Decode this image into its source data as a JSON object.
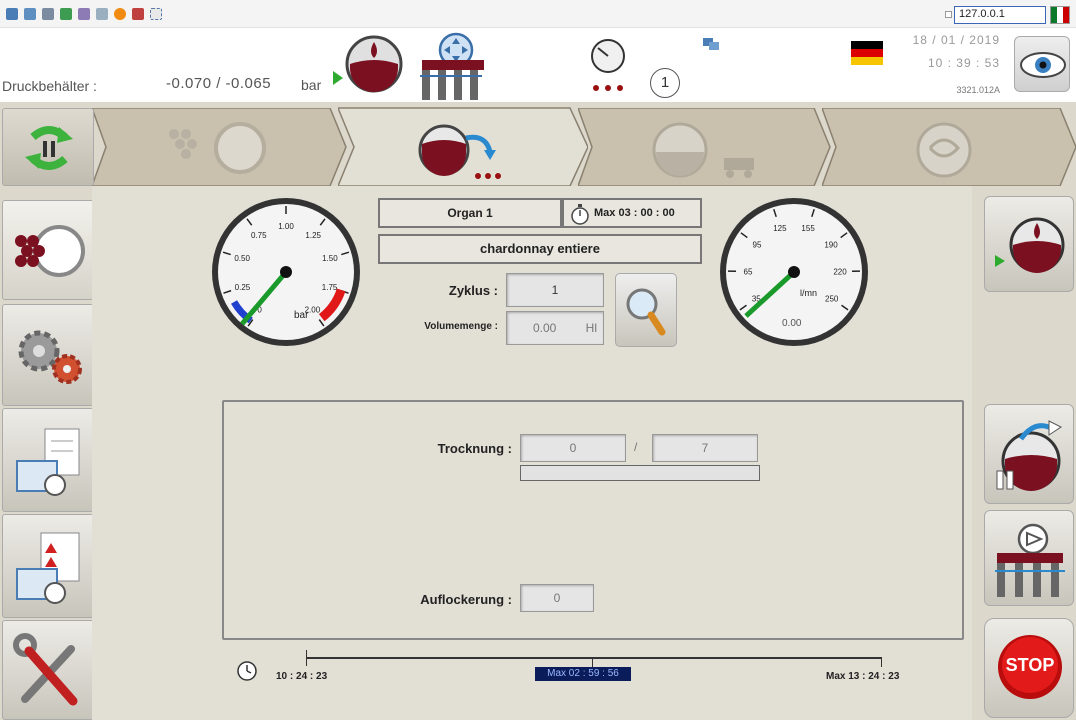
{
  "toolbar": {
    "ip_address": "127.0.0.1"
  },
  "header": {
    "druck_label": "Druckbehälter :",
    "druck_values": "-0.070  /  -0.065",
    "druck_unit": "bar",
    "counter": "1",
    "date": "18 / 01 / 2019",
    "time": "10 : 39 : 53",
    "code": "3321.012A"
  },
  "gauge_left": {
    "ticks": [
      "0",
      "0.25",
      "0.50",
      "0.75",
      "1.00",
      "1.25",
      "1.50",
      "1.75",
      "2.00"
    ],
    "unit": "bar"
  },
  "gauge_right": {
    "ticks": [
      "35",
      "65",
      "95",
      "125",
      "155",
      "190",
      "220",
      "250"
    ],
    "unit": "l/mn",
    "value_text": "0.00"
  },
  "program": {
    "name": "Organ 1",
    "timer": "Max 03 : 00 : 00",
    "product": "chardonnay entiere",
    "zyklus_label": "Zyklus :",
    "zyklus_value": "1",
    "volumen_label": "Volumemenge :",
    "volumen_value": "0.00",
    "volumen_unit": "Hl"
  },
  "panel": {
    "trocknung_label": "Trocknung :",
    "trocknung_value": "0",
    "trocknung_sep": "/",
    "trocknung_total": "7",
    "trocknung_progress": 0.0,
    "auflockerung_label": "Auflockerung :",
    "auflockerung_value": "0"
  },
  "timeline": {
    "start": "10 : 24 : 23",
    "current": "Max 02 : 59 : 56",
    "end": "Max 13 : 24 : 23"
  },
  "buttons": {
    "stop_label": "STOP"
  },
  "colors": {
    "wine": "#7a1020",
    "gauge_needle": "#1a9a2a",
    "stop_red": "#d41010",
    "flow_blue": "#2a8ad0"
  }
}
